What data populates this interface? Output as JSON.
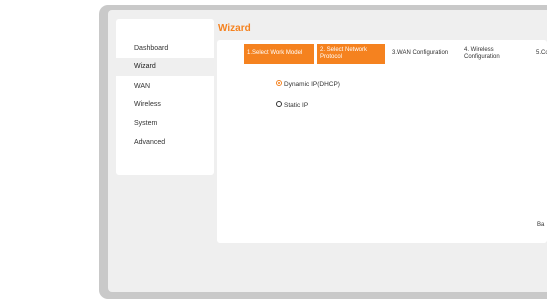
{
  "sidebar": {
    "items": [
      {
        "label": "Dashboard"
      },
      {
        "label": "Wizard"
      },
      {
        "label": "WAN"
      },
      {
        "label": "Wireless"
      },
      {
        "label": "System"
      },
      {
        "label": "Advanced"
      }
    ],
    "active_index": 1
  },
  "page": {
    "title": "Wizard"
  },
  "steps": [
    {
      "label": "1.Select Work Model",
      "state": "done"
    },
    {
      "label": "2. Select Network Protocol",
      "state": "done"
    },
    {
      "label": "3.WAN Configuration",
      "state": "pending"
    },
    {
      "label": "4. Wireless Configuration",
      "state": "pending"
    },
    {
      "label": "5.Co",
      "state": "pending"
    }
  ],
  "protocol_options": [
    {
      "label": "Dynamic IP(DHCP)",
      "checked": true
    },
    {
      "label": "Static IP",
      "checked": false
    }
  ],
  "footer": {
    "back_label": "Ba"
  },
  "colors": {
    "accent": "#f5821f",
    "frame": "#c9c9c9",
    "screen_bg": "#efefef",
    "panel_bg": "#ffffff"
  }
}
